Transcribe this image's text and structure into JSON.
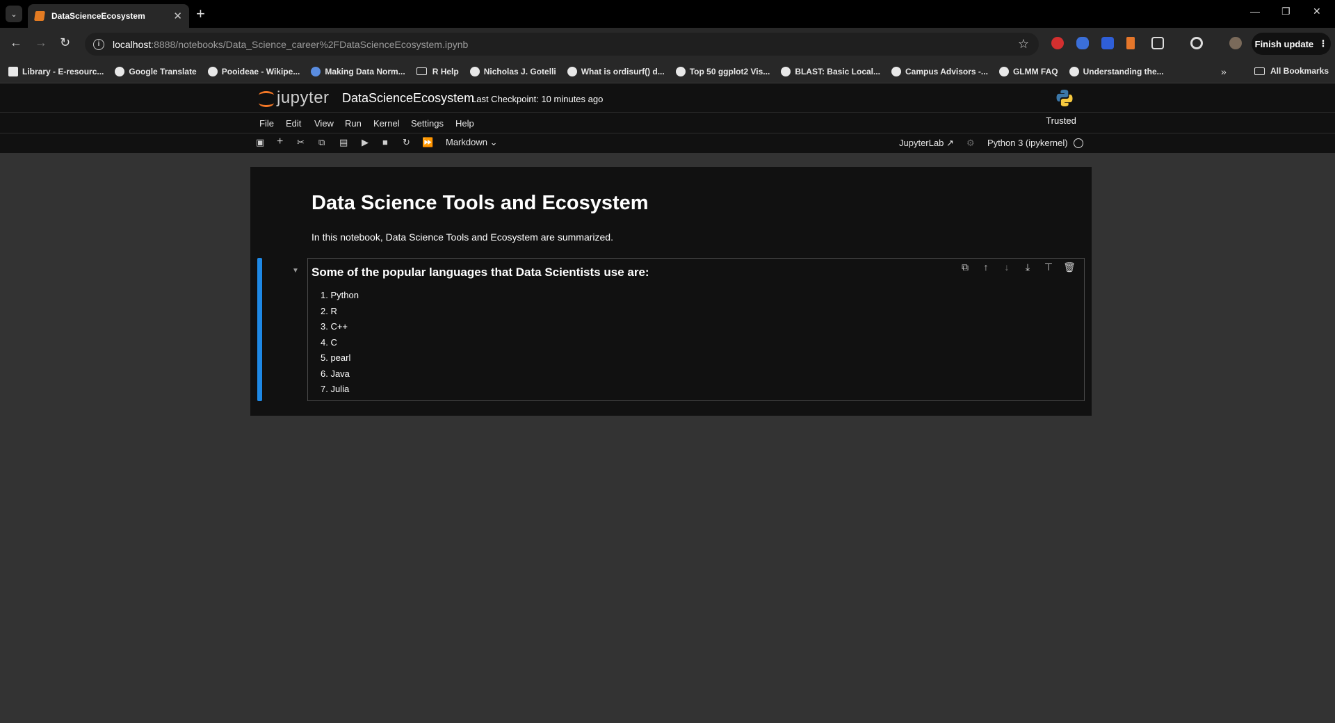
{
  "browser": {
    "tab_title": "DataScienceEcosystem",
    "url_host": "localhost",
    "url_rest": ":8888/notebooks/Data_Science_career%2FDataScienceEcosystem.ipynb",
    "finish_update": "Finish update",
    "bookmarks": [
      "Library - E-resourc...",
      "Google Translate",
      "Pooideae - Wikipe...",
      "Making Data Norm...",
      "R Help",
      "Nicholas J. Gotelli",
      "What is ordisurf() d...",
      "Top 50 ggplot2 Vis...",
      "BLAST: Basic Local...",
      "Campus Advisors -...",
      "GLMM FAQ",
      "Understanding the..."
    ],
    "all_bookmarks": "All Bookmarks"
  },
  "jupyter": {
    "logo_text": "jupyter",
    "notebook_name": "DataScienceEcosystem",
    "checkpoint": "Last Checkpoint: 10 minutes ago",
    "trusted": "Trusted",
    "menu": [
      "File",
      "Edit",
      "View",
      "Run",
      "Kernel",
      "Settings",
      "Help"
    ],
    "cell_type": "Markdown",
    "jupyterlab_link": "JupyterLab",
    "kernel_name": "Python 3 (ipykernel)"
  },
  "notebook": {
    "title": "Data Science Tools and Ecosystem",
    "intro": "In this notebook, Data Science Tools and Ecosystem are summarized.",
    "languages_heading": "Some of the popular languages that Data Scientists use are:",
    "languages": [
      "1. Python",
      "2. R",
      "3. C++",
      "4. C",
      "5. pearl",
      "6. Java",
      "7. Julia"
    ]
  },
  "colors": {
    "accent_blue": "#1e88e5",
    "jupyter_orange": "#f37726"
  }
}
